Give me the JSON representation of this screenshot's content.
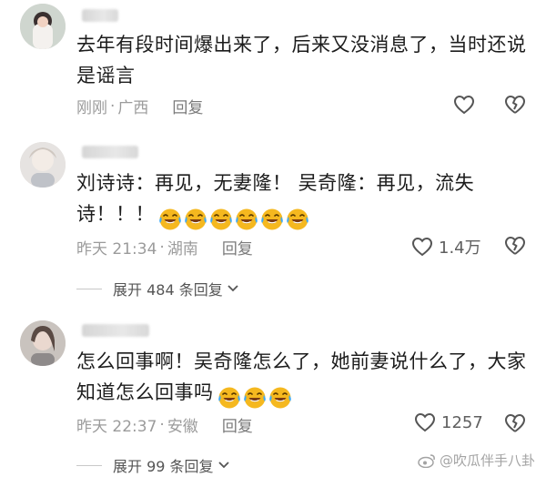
{
  "comments": [
    {
      "text": "去年有段时间爆出来了，后来又没消息了，当时还说是谣言",
      "time": "刚刚",
      "location": "广西",
      "reply_label": "回复",
      "like_count": "",
      "emoji_count": 0
    },
    {
      "text": "刘诗诗：再见，无妻隆！  吴奇隆：再见，流失诗！！！",
      "time": "昨天 21:34",
      "location": "湖南",
      "reply_label": "回复",
      "like_count": "1.4万",
      "emoji_count": 6,
      "expand_label": "展开 484 条回复"
    },
    {
      "text": "怎么回事啊！吴奇隆怎么了，她前妻说什么了，大家知道怎么回事吗",
      "time": "昨天 22:37",
      "location": "安徽",
      "reply_label": "回复",
      "like_count": "1257",
      "emoji_count": 3,
      "expand_label": "展开 99 条回复"
    }
  ],
  "separator": "·",
  "watermark": "@吹瓜伴手八卦",
  "emoji_name": "laughing-crying-emoji",
  "colors": {
    "meta": "#9b9b9b",
    "text": "#1c1c1c",
    "emoji": "#f5b81f"
  }
}
